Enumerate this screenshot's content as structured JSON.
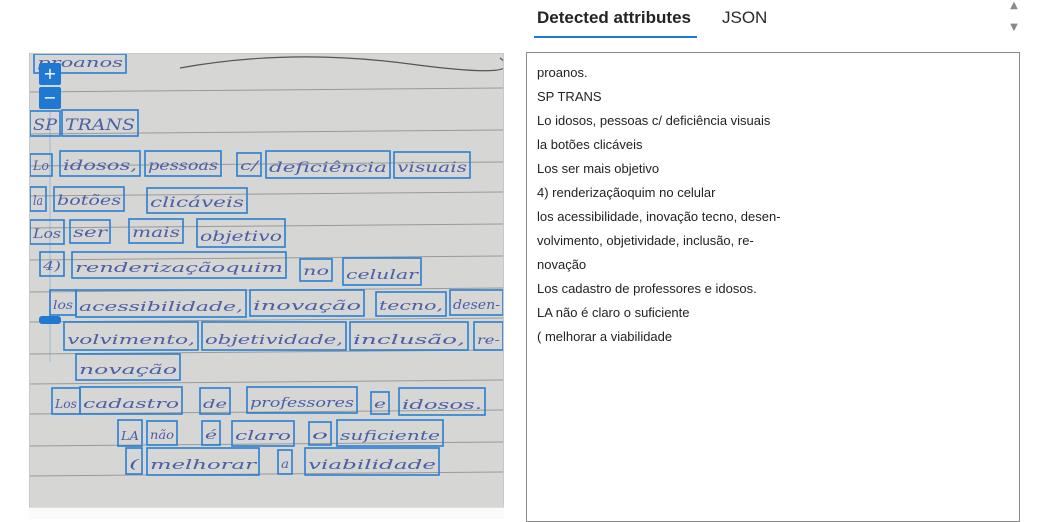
{
  "tabs": {
    "detected": "Detected attributes",
    "json": "JSON"
  },
  "image_panel": {
    "zoom_in": "+",
    "zoom_out": "−",
    "handwritten_words": [
      "proanos",
      "SP",
      "TRANS",
      "Lo",
      "idosos,",
      "pessoas",
      "c/",
      "deficiência",
      "visuais",
      "la",
      "botões",
      "clicáveis",
      "Los",
      "ser",
      "mais",
      "objetivo",
      "4)",
      "renderizaçãoquim",
      "no",
      "celular",
      "los",
      "acessibilidade,",
      "inovação",
      "tecno,",
      "desen-",
      "volvimento,",
      "objetividade,",
      "inclusão,",
      "re-",
      "novação",
      "Los",
      "cadastro",
      "de",
      "professores",
      "e",
      "idosos.",
      "LA",
      "não",
      "é",
      "claro",
      "o",
      "suficiente",
      "(",
      "melhorar",
      "a",
      "viabilidade"
    ]
  },
  "text_lines": [
    "proanos.",
    "SP TRANS",
    "Lo idosos, pessoas c/ deficiência visuais",
    "la botões clicáveis",
    "Los ser mais objetivo",
    "4) renderizaçãoquim no celular",
    "los acessibilidade, inovação tecno, desen-",
    "volvimento, objetividade, inclusão, re-",
    "novação",
    "Los cadastro de professores e idosos.",
    "LA não é claro o suficiente",
    "( melhorar a viabilidade"
  ],
  "icons": {
    "scroll_up": "triangle-up",
    "scroll_down": "triangle-down"
  },
  "colors": {
    "accent": "#1f78d1",
    "box": "#2a7fd4",
    "ink": "#4a5fa8",
    "paper": "#d6d6d4"
  }
}
